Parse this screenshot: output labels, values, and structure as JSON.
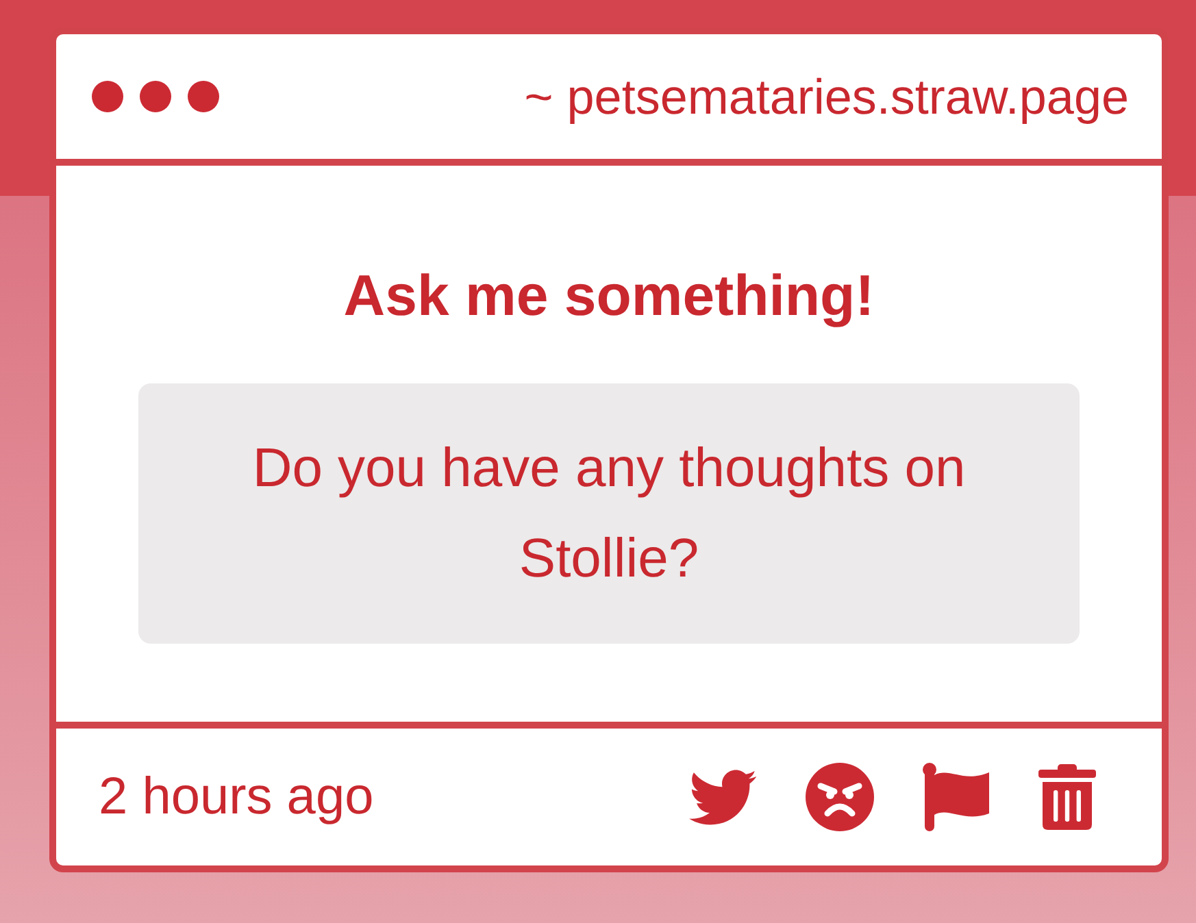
{
  "header": {
    "address": "~ petsemataries.straw.page"
  },
  "prompt": {
    "title": "Ask me something!",
    "question": "Do you have any thoughts on Stollie?"
  },
  "footer": {
    "time": "2 hours ago"
  }
}
